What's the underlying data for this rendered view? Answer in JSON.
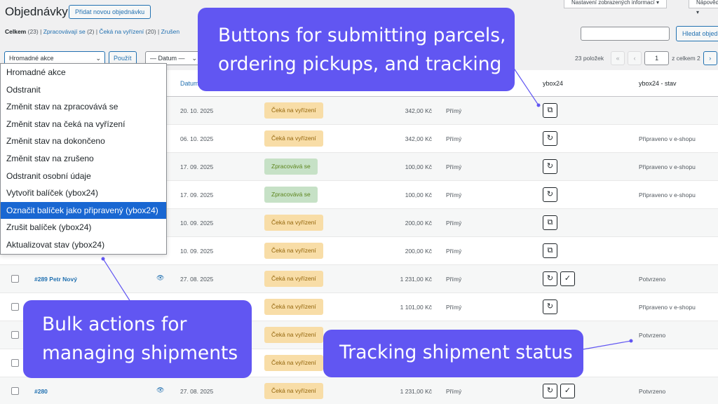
{
  "header": {
    "title": "Objednávky",
    "add_new": "Přidat novou objednávku",
    "screen_options": "Nastavení zobrazených informací ▾",
    "help": "Nápověda ▾"
  },
  "filters": {
    "all": "Celkem",
    "all_count": "(23)",
    "processing": "Zpracovávají se",
    "processing_count": "(2)",
    "on_hold": "Čeká na vyřízení",
    "on_hold_count": "(20)",
    "cancelled": "Zrušen"
  },
  "search": {
    "button": "Hledat objed"
  },
  "toolbar": {
    "bulk_label": "Hromadné akce",
    "apply": "Použít",
    "date_filter": "— Datum —"
  },
  "pagination": {
    "items": "23 položek",
    "first": "«",
    "prev": "‹",
    "current": "1",
    "of": "z celkem 2",
    "next": "›"
  },
  "columns": {
    "date": "Datum",
    "ybox24": "ybox24",
    "ybox24_status": "ybox24 - stav"
  },
  "bulk_menu": [
    "Hromadné akce",
    "Odstranit",
    "Změnit stav na zpracovává se",
    "Změnit stav na čeká na vyřízení",
    "Změnit stav na dokončeno",
    "Změnit stav na zrušeno",
    "Odstranit osobní údaje",
    "Vytvořit balíček (ybox24)",
    "Označit balíček jako připravený (ybox24)",
    "Zrušit balíček (ybox24)",
    "Aktualizovat stav (ybox24)"
  ],
  "bulk_menu_selected": 8,
  "rows": [
    {
      "order": "",
      "date": "20. 10. 2025",
      "status": "Čeká na vyřízení",
      "status_type": "on-hold",
      "total": "342,00 Kč",
      "shipping": "Přímý",
      "actions": [
        "external-link"
      ],
      "ybox_status": ""
    },
    {
      "order": "",
      "date": "06. 10. 2025",
      "status": "Čeká na vyřízení",
      "status_type": "on-hold",
      "total": "342,00 Kč",
      "shipping": "Přímý",
      "actions": [
        "refresh"
      ],
      "ybox_status": "Připraveno v e-shopu"
    },
    {
      "order": "",
      "date": "17. 09. 2025",
      "status": "Zpracovává se",
      "status_type": "processing",
      "total": "100,00 Kč",
      "shipping": "Přímý",
      "actions": [
        "refresh"
      ],
      "ybox_status": "Připraveno v e-shopu"
    },
    {
      "order": "",
      "date": "17. 09. 2025",
      "status": "Zpracovává se",
      "status_type": "processing",
      "total": "100,00 Kč",
      "shipping": "Přímý",
      "actions": [
        "refresh"
      ],
      "ybox_status": "Připraveno v e-shopu"
    },
    {
      "order": "",
      "date": "10. 09. 2025",
      "status": "Čeká na vyřízení",
      "status_type": "on-hold",
      "total": "200,00 Kč",
      "shipping": "Přímý",
      "actions": [
        "external-link"
      ],
      "ybox_status": ""
    },
    {
      "order": "",
      "date": "10. 09. 2025",
      "status": "Čeká na vyřízení",
      "status_type": "on-hold",
      "total": "200,00 Kč",
      "shipping": "Přímý",
      "actions": [
        "external-link"
      ],
      "ybox_status": ""
    },
    {
      "order": "#289 Petr Nový",
      "date": "27. 08. 2025",
      "status": "Čeká na vyřízení",
      "status_type": "on-hold",
      "total": "1 231,00 Kč",
      "shipping": "Přímý",
      "actions": [
        "refresh",
        "check"
      ],
      "ybox_status": "Potvrzeno"
    },
    {
      "order": "",
      "date": "",
      "status": "Čeká na vyřízení",
      "status_type": "on-hold",
      "total": "1 101,00 Kč",
      "shipping": "Přímý",
      "actions": [
        "refresh"
      ],
      "ybox_status": "Připraveno v e-shopu"
    },
    {
      "order": "",
      "date": "",
      "status": "Čeká na vyřízení",
      "status_type": "on-hold",
      "total": "",
      "shipping": "",
      "actions": [],
      "ybox_status": "Potvrzeno"
    },
    {
      "order": "",
      "date": "",
      "status": "Čeká na vyřízení",
      "status_type": "on-hold",
      "total": "",
      "shipping": "",
      "actions": [],
      "ybox_status": ""
    },
    {
      "order": "#280",
      "date": "27. 08. 2025",
      "status": "Čeká na vyřízení",
      "status_type": "on-hold",
      "total": "1 231,00 Kč",
      "shipping": "Přímý",
      "actions": [
        "refresh",
        "check"
      ],
      "ybox_status": "Potvrzeno"
    }
  ],
  "icons": {
    "eye": "eye-icon",
    "external-link": "external-link-icon",
    "refresh": "refresh-icon",
    "check": "check-icon"
  },
  "colors": {
    "callout": "#6156f2",
    "link": "#2271b1",
    "selected": "#1967d2",
    "on_hold_bg": "#f8dda7",
    "processing_bg": "#c6e1c6"
  },
  "callouts": {
    "buttons": "Buttons for submitting parcels, ordering pickups, and tracking",
    "bulk": "Bulk actions for managing shipments",
    "tracking": "Tracking shipment status"
  }
}
